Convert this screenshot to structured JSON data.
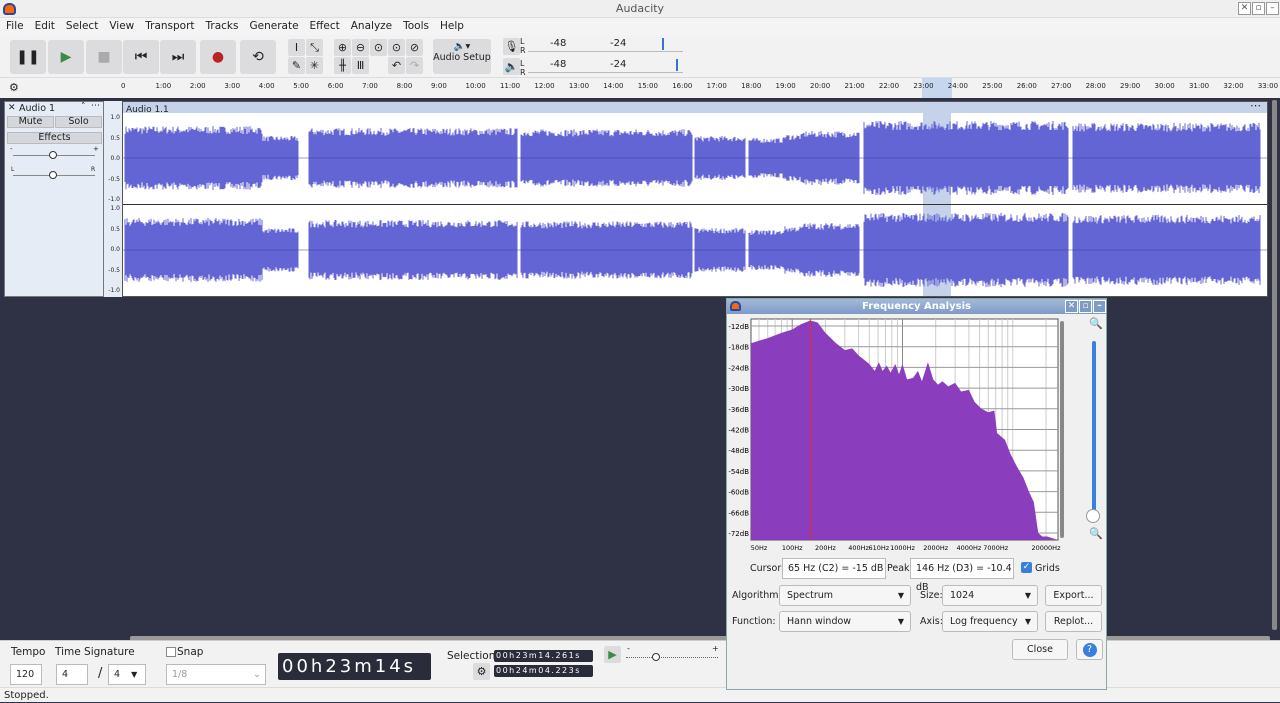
{
  "window": {
    "title": "Audacity"
  },
  "menu": [
    "File",
    "Edit",
    "Select",
    "View",
    "Transport",
    "Tracks",
    "Generate",
    "Effect",
    "Analyze",
    "Tools",
    "Help"
  ],
  "toolbar": {
    "audio_setup": "Audio Setup",
    "meter_ticks": [
      "-48",
      "-24"
    ],
    "rec_lr": [
      "L",
      "R"
    ],
    "play_lr": [
      "L",
      "R"
    ]
  },
  "ruler": {
    "ticks": [
      "0",
      "1:00",
      "2:00",
      "3:00",
      "4:00",
      "5:00",
      "6:00",
      "7:00",
      "8:00",
      "9:00",
      "10:00",
      "11:00",
      "12:00",
      "13:00",
      "14:00",
      "15:00",
      "16:00",
      "17:00",
      "18:00",
      "19:00",
      "20:00",
      "21:00",
      "22:00",
      "23:00",
      "24:00",
      "25:00",
      "26:00",
      "27:00",
      "28:00",
      "29:00",
      "30:00",
      "31:00",
      "32:00",
      "33:00"
    ]
  },
  "track": {
    "name": "Audio 1",
    "clip": "Audio 1.1",
    "mute": "Mute",
    "solo": "Solo",
    "effects": "Effects",
    "gain_minus": "-",
    "gain_plus": "+",
    "pan_l": "L",
    "pan_r": "R",
    "scale": [
      "1.0",
      "0.5",
      "0.0",
      "-0.5",
      "-1.0"
    ],
    "waveform_color": "#6465d5"
  },
  "freq": {
    "title": "Frequency Analysis",
    "db_ticks": [
      "-12dB",
      "-18dB",
      "-24dB",
      "-30dB",
      "-36dB",
      "-42dB",
      "-48dB",
      "-54dB",
      "-60dB",
      "-66dB",
      "-72dB"
    ],
    "freq_ticks": [
      "50Hz",
      "100Hz",
      "200Hz",
      "400Hz",
      "610Hz",
      "1000Hz",
      "2000Hz",
      "4000Hz",
      "7000Hz",
      "20000Hz"
    ],
    "cursor_label": "Cursor:",
    "cursor_value": "65 Hz (C2) = -15 dB",
    "peak_label": "Peak:",
    "peak_value": "146 Hz (D3) = -10.4 dB",
    "grids_label": "Grids",
    "grids_checked": true,
    "algorithm_label": "Algorithm:",
    "algorithm": "Spectrum",
    "size_label": "Size:",
    "size": "1024",
    "export": "Export...",
    "function_label": "Function:",
    "function": "Hann window",
    "axis_label": "Axis:",
    "axis": "Log frequency",
    "replot": "Replot...",
    "close": "Close",
    "help": "?",
    "spectrum_color": "#8a3dbd",
    "marker_hz": 146,
    "spectrum": [
      [
        42,
        -17
      ],
      [
        60,
        -15.5
      ],
      [
        80,
        -14
      ],
      [
        100,
        -13
      ],
      [
        120,
        -11.5
      ],
      [
        146,
        -10.4
      ],
      [
        170,
        -11
      ],
      [
        200,
        -14
      ],
      [
        250,
        -17
      ],
      [
        300,
        -19
      ],
      [
        350,
        -18.5
      ],
      [
        400,
        -20.5
      ],
      [
        500,
        -23
      ],
      [
        560,
        -25
      ],
      [
        610,
        -22.5
      ],
      [
        660,
        -25
      ],
      [
        720,
        -23.5
      ],
      [
        780,
        -25.5
      ],
      [
        860,
        -23
      ],
      [
        930,
        -26
      ],
      [
        1000,
        -23
      ],
      [
        1100,
        -27.5
      ],
      [
        1250,
        -27
      ],
      [
        1380,
        -25
      ],
      [
        1500,
        -28
      ],
      [
        1700,
        -22.5
      ],
      [
        1900,
        -27.5
      ],
      [
        2100,
        -29
      ],
      [
        2300,
        -28
      ],
      [
        2600,
        -29.5
      ],
      [
        3000,
        -28.5
      ],
      [
        3400,
        -31
      ],
      [
        4000,
        -30.5
      ],
      [
        4500,
        -34
      ],
      [
        5200,
        -36
      ],
      [
        6000,
        -37
      ],
      [
        6800,
        -36.5
      ],
      [
        7200,
        -43
      ],
      [
        8500,
        -45
      ],
      [
        9500,
        -49
      ],
      [
        11000,
        -53
      ],
      [
        12500,
        -56
      ],
      [
        14000,
        -60
      ],
      [
        15500,
        -63
      ],
      [
        17000,
        -72
      ],
      [
        18500,
        -73
      ],
      [
        20500,
        -73
      ]
    ]
  },
  "bottom": {
    "tempo_label": "Tempo",
    "tempo": "120",
    "timesig_label": "Time Signature",
    "timesig_num": "4",
    "timesig_sep": "/",
    "timesig_den": "4",
    "snap_label": "Snap",
    "snap_value": "1/8",
    "time": "00h23m14s",
    "selection_label": "Selection",
    "sel_start": "00h23m14.261s",
    "sel_end": "00h24m04.223s",
    "speed_minus": "-",
    "speed_plus": "+"
  },
  "status": "Stopped."
}
